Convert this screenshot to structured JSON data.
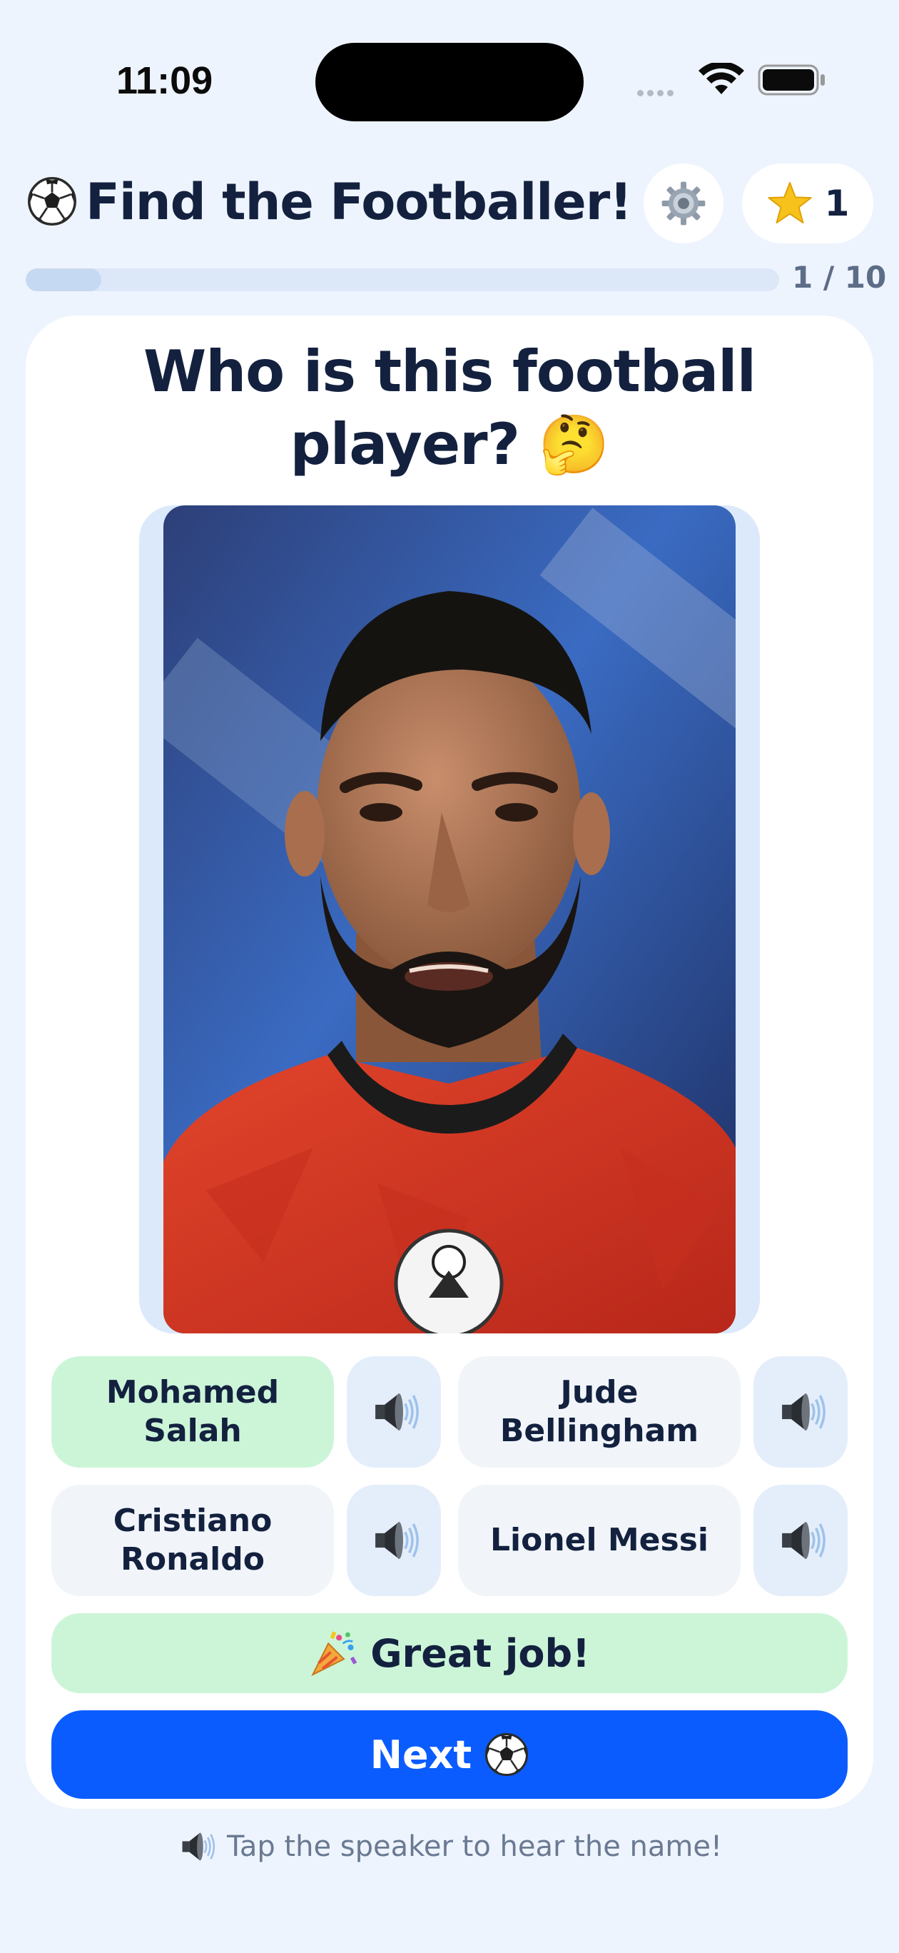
{
  "status_bar": {
    "time": "11:09"
  },
  "header": {
    "title": "Find the Footballer!",
    "title_icon": "soccer-ball-icon",
    "settings_icon": "gear-icon",
    "score_icon": "star-icon",
    "score": "1"
  },
  "progress": {
    "text": "1 / 10",
    "current": 1,
    "total": 10
  },
  "question": {
    "text": "Who is this football player? 🤔"
  },
  "options": [
    {
      "label": "Mohamed Salah",
      "state": "correct"
    },
    {
      "label": "Jude Bellingham",
      "state": "default"
    },
    {
      "label": "Cristiano Ronaldo",
      "state": "default"
    },
    {
      "label": "Lionel Messi",
      "state": "default"
    }
  ],
  "feedback": {
    "text": "Great job!",
    "icon": "party-popper-icon"
  },
  "next_button": {
    "label": "Next",
    "icon": "soccer-ball-icon"
  },
  "hint": {
    "text": "Tap the speaker to hear the name!",
    "icon": "speaker-icon"
  },
  "colors": {
    "background": "#eef4fd",
    "primary": "#0a5cff",
    "correct": "#ccf5d8",
    "text": "#13213f"
  }
}
